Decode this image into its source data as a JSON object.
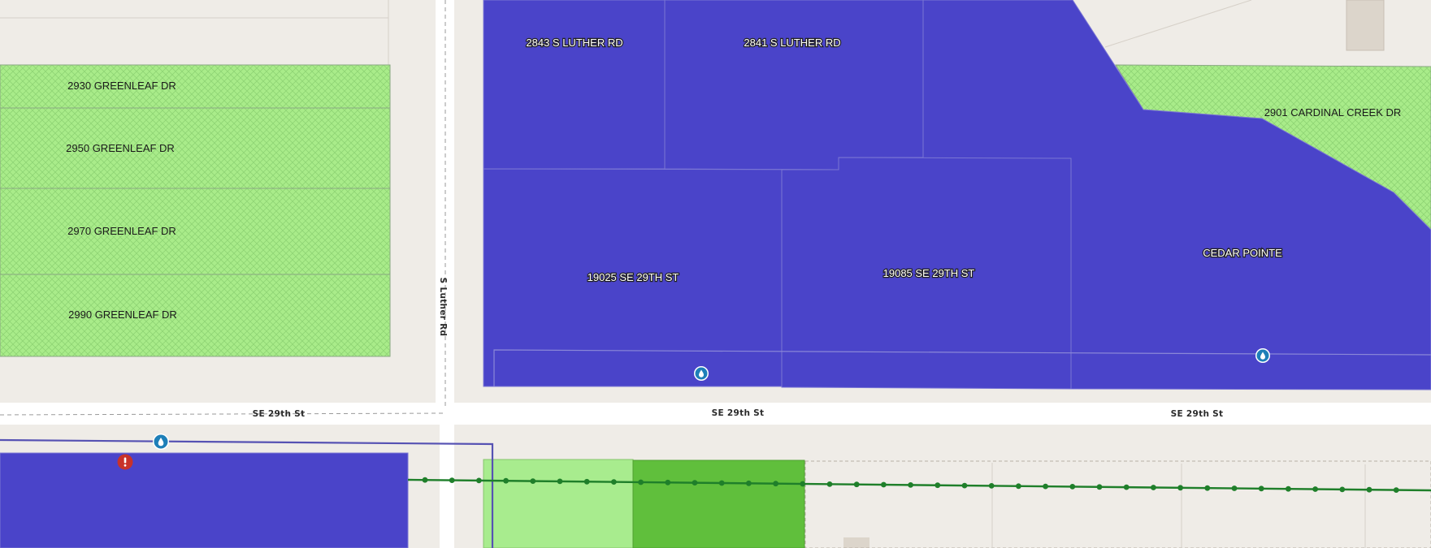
{
  "map": {
    "colors": {
      "background": "#efece7",
      "road": "#ffffff",
      "blue_parcel": "#4a44c9",
      "green_parcel": "#a9ec8a",
      "green_light": "#a8ec8e",
      "green_dark": "#60bf3c",
      "utility_line": "#1f7f2a",
      "water_marker": "#1e7fb8",
      "alert_marker": "#c8322a"
    },
    "icons": {
      "water": "water-drop-icon",
      "alert": "exclamation-alert-icon"
    },
    "roads": {
      "s_luther_rd": "S Luther Rd",
      "se29_west": "SE 29th St",
      "se29_mid": "SE 29th St",
      "se29_east": "SE 29th St"
    },
    "parcels": {
      "p2843": "2843 S LUTHER RD",
      "p2841": "2841 S LUTHER RD",
      "p19025": "19025 SE 29TH ST",
      "p19085": "19085 SE 29TH ST",
      "cedar": "CEDAR POINTE",
      "p2901": "2901 CARDINAL CREEK DR",
      "p2930": "2930 GREENLEAF DR",
      "p2950": "2950 GREENLEAF DR",
      "p2970": "2970 GREENLEAF DR",
      "p2990": "2990 GREENLEAF DR"
    }
  }
}
